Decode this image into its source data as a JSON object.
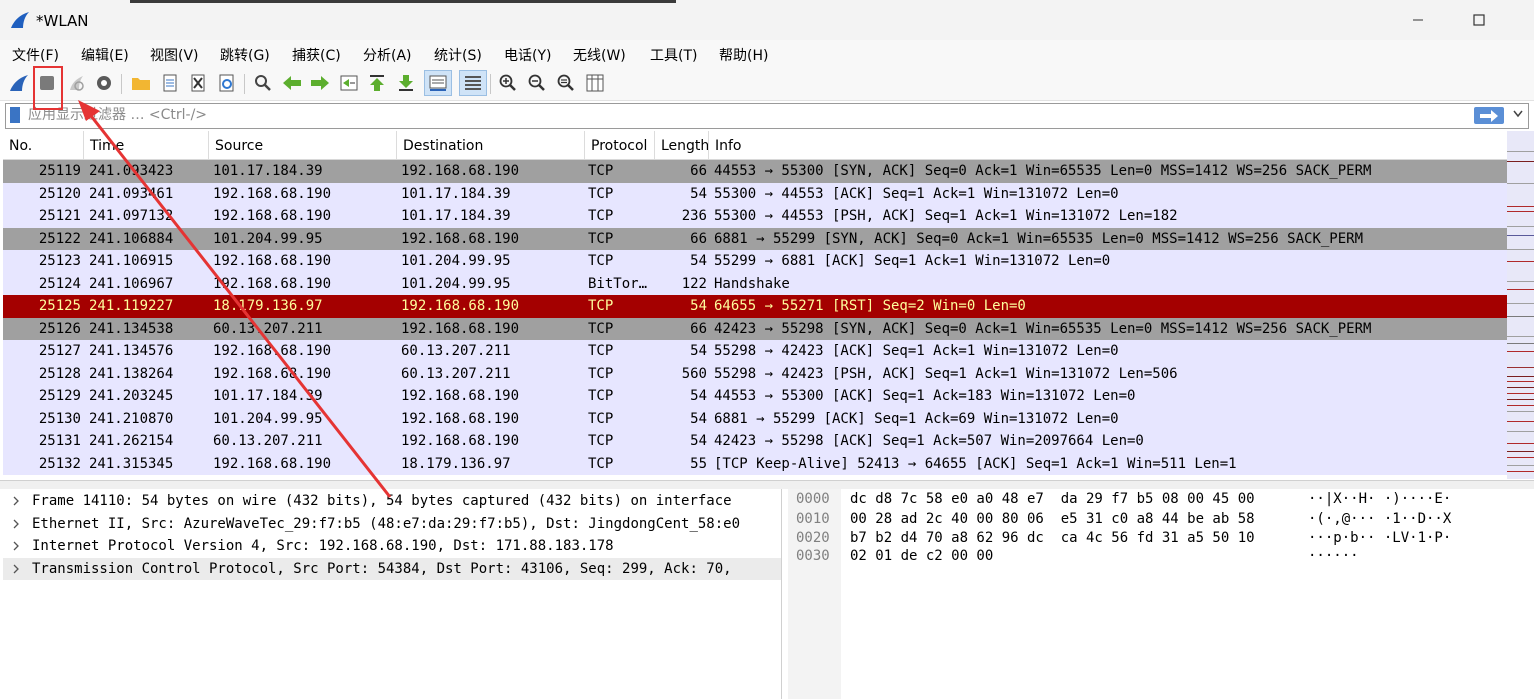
{
  "window": {
    "title": "*WLAN"
  },
  "menu": [
    "文件(F)",
    "编辑(E)",
    "视图(V)",
    "跳转(G)",
    "捕获(C)",
    "分析(A)",
    "统计(S)",
    "电话(Y)",
    "无线(W)",
    "工具(T)",
    "帮助(H)"
  ],
  "toolbar": {
    "icons": [
      "shark-fin-start-icon",
      "stop-square-icon",
      "restart-icon",
      "options-gear-icon",
      "open-folder-icon",
      "file-icon",
      "close-file-icon",
      "reload-icon",
      "find-magnifier-icon",
      "back-arrow-icon",
      "forward-arrow-icon",
      "go-to-packet-icon",
      "first-packet-icon",
      "last-packet-icon",
      "autoscroll-icon",
      "colorize-icon",
      "zoom-in-icon",
      "zoom-out-icon",
      "zoom-reset-icon",
      "resize-columns-icon"
    ]
  },
  "filter": {
    "placeholder": "应用显示过滤器 … <Ctrl-/>",
    "value": ""
  },
  "columns": {
    "no": "No.",
    "time": "Time",
    "source": "Source",
    "destination": "Destination",
    "protocol": "Protocol",
    "length": "Length",
    "info": "Info"
  },
  "packets": [
    {
      "no": "25119",
      "time": "241.093423",
      "src": "101.17.184.39",
      "dst": "192.168.68.190",
      "proto": "TCP",
      "len": "66",
      "info": "44553 → 55300 [SYN, ACK] Seq=0 Ack=1 Win=65535 Len=0 MSS=1412 WS=256 SACK_PERM",
      "style": "gray"
    },
    {
      "no": "25120",
      "time": "241.093461",
      "src": "192.168.68.190",
      "dst": "101.17.184.39",
      "proto": "TCP",
      "len": "54",
      "info": "55300 → 44553 [ACK] Seq=1 Ack=1 Win=131072 Len=0",
      "style": "lav"
    },
    {
      "no": "25121",
      "time": "241.097132",
      "src": "192.168.68.190",
      "dst": "101.17.184.39",
      "proto": "TCP",
      "len": "236",
      "info": "55300 → 44553 [PSH, ACK] Seq=1 Ack=1 Win=131072 Len=182",
      "style": "lav"
    },
    {
      "no": "25122",
      "time": "241.106884",
      "src": "101.204.99.95",
      "dst": "192.168.68.190",
      "proto": "TCP",
      "len": "66",
      "info": "6881 → 55299 [SYN, ACK] Seq=0 Ack=1 Win=65535 Len=0 MSS=1412 WS=256 SACK_PERM",
      "style": "gray"
    },
    {
      "no": "25123",
      "time": "241.106915",
      "src": "192.168.68.190",
      "dst": "101.204.99.95",
      "proto": "TCP",
      "len": "54",
      "info": "55299 → 6881 [ACK] Seq=1 Ack=1 Win=131072 Len=0",
      "style": "lav"
    },
    {
      "no": "25124",
      "time": "241.106967",
      "src": "192.168.68.190",
      "dst": "101.204.99.95",
      "proto": "BitTor…",
      "len": "122",
      "info": "Handshake",
      "style": "lav"
    },
    {
      "no": "25125",
      "time": "241.119227",
      "src": "18.179.136.97",
      "dst": "192.168.68.190",
      "proto": "TCP",
      "len": "54",
      "info": "64655 → 55271 [RST] Seq=2 Win=0 Len=0",
      "style": "red"
    },
    {
      "no": "25126",
      "time": "241.134538",
      "src": "60.13.207.211",
      "dst": "192.168.68.190",
      "proto": "TCP",
      "len": "66",
      "info": "42423 → 55298 [SYN, ACK] Seq=0 Ack=1 Win=65535 Len=0 MSS=1412 WS=256 SACK_PERM",
      "style": "gray"
    },
    {
      "no": "25127",
      "time": "241.134576",
      "src": "192.168.68.190",
      "dst": "60.13.207.211",
      "proto": "TCP",
      "len": "54",
      "info": "55298 → 42423 [ACK] Seq=1 Ack=1 Win=131072 Len=0",
      "style": "lav"
    },
    {
      "no": "25128",
      "time": "241.138264",
      "src": "192.168.68.190",
      "dst": "60.13.207.211",
      "proto": "TCP",
      "len": "560",
      "info": "55298 → 42423 [PSH, ACK] Seq=1 Ack=1 Win=131072 Len=506",
      "style": "lav"
    },
    {
      "no": "25129",
      "time": "241.203245",
      "src": "101.17.184.39",
      "dst": "192.168.68.190",
      "proto": "TCP",
      "len": "54",
      "info": "44553 → 55300 [ACK] Seq=1 Ack=183 Win=131072 Len=0",
      "style": "lav"
    },
    {
      "no": "25130",
      "time": "241.210870",
      "src": "101.204.99.95",
      "dst": "192.168.68.190",
      "proto": "TCP",
      "len": "54",
      "info": "6881 → 55299 [ACK] Seq=1 Ack=69 Win=131072 Len=0",
      "style": "lav"
    },
    {
      "no": "25131",
      "time": "241.262154",
      "src": "60.13.207.211",
      "dst": "192.168.68.190",
      "proto": "TCP",
      "len": "54",
      "info": "42423 → 55298 [ACK] Seq=1 Ack=507 Win=2097664 Len=0",
      "style": "lav"
    },
    {
      "no": "25132",
      "time": "241.315345",
      "src": "192.168.68.190",
      "dst": "18.179.136.97",
      "proto": "TCP",
      "len": "55",
      "info": "[TCP Keep-Alive] 52413 → 64655 [ACK] Seq=1 Ack=1 Win=511 Len=1",
      "style": "lav"
    }
  ],
  "details": [
    "Frame 14110: 54 bytes on wire (432 bits), 54 bytes captured (432 bits) on interface",
    "Ethernet II, Src: AzureWaveTec_29:f7:b5 (48:e7:da:29:f7:b5), Dst: JingdongCent_58:e0",
    "Internet Protocol Version 4, Src: 192.168.68.190, Dst: 171.88.183.178",
    "Transmission Control Protocol, Src Port: 54384, Dst Port: 43106, Seq: 299, Ack: 70,"
  ],
  "bytes": [
    {
      "offset": "0000",
      "hex": "dc d8 7c 58 e0 a0 48 e7  da 29 f7 b5 08 00 45 00",
      "ascii": "··|X··H· ·)····E·"
    },
    {
      "offset": "0010",
      "hex": "00 28 ad 2c 40 00 80 06  e5 31 c0 a8 44 be ab 58",
      "ascii": "·(·,@··· ·1··D··X"
    },
    {
      "offset": "0020",
      "hex": "b7 b2 d4 70 a8 62 96 dc  ca 4c 56 fd 31 a5 50 10",
      "ascii": "···p·b·· ·LV·1·P·"
    },
    {
      "offset": "0030",
      "hex": "02 01 de c2 00 00",
      "ascii": "······"
    }
  ],
  "colors": {
    "row_gray": "#a0a0a0",
    "row_lav": "#e7e6ff",
    "row_red": "#a40000",
    "row_red_text": "#fffc9c",
    "annotation": "#e53434"
  }
}
